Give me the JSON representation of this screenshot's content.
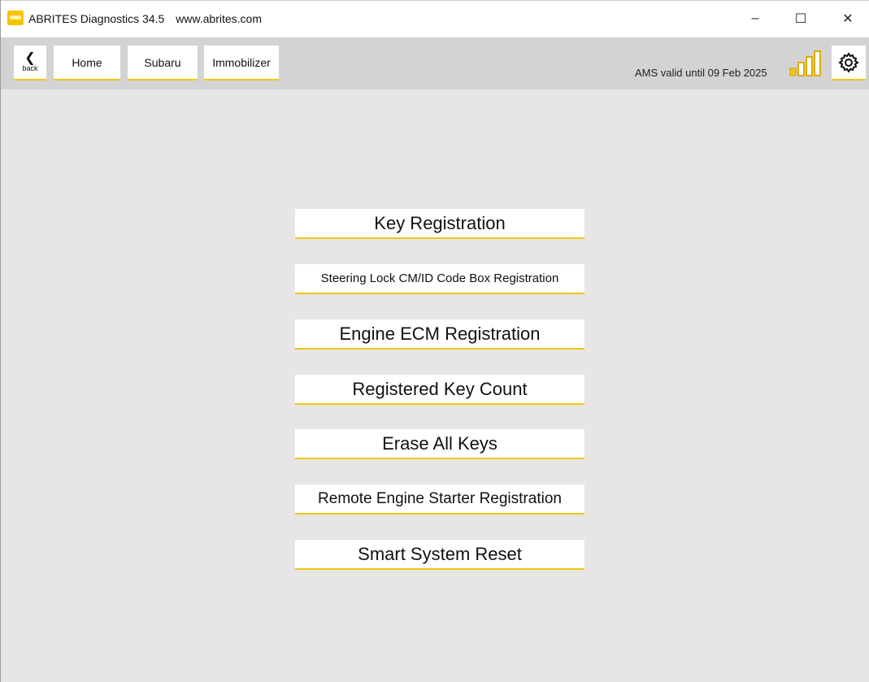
{
  "window": {
    "app_name": "ABRITES Diagnostics 34.5",
    "url": "www.abrites.com",
    "minimize": "–",
    "maximize": "☐",
    "close": "✕"
  },
  "toolbar": {
    "back_label": "back",
    "crumbs": [
      "Home",
      "Subaru",
      "Immobilizer"
    ],
    "ams_status": "AMS valid until 09 Feb 2025",
    "signal_bars_filled": 1,
    "signal_bars_total": 4,
    "accent_color": "#f3c614"
  },
  "menu": {
    "items": [
      "Key Registration",
      "Steering Lock CM/ID Code Box Registration",
      "Engine ECM Registration",
      "Registered Key Count",
      "Erase All Keys",
      "Remote Engine Starter Registration",
      "Smart System Reset"
    ]
  },
  "icons": {
    "back": "chevron-left-icon",
    "settings": "gear-icon",
    "signal": "signal-strength-icon",
    "app": "abrites-logo-icon"
  }
}
